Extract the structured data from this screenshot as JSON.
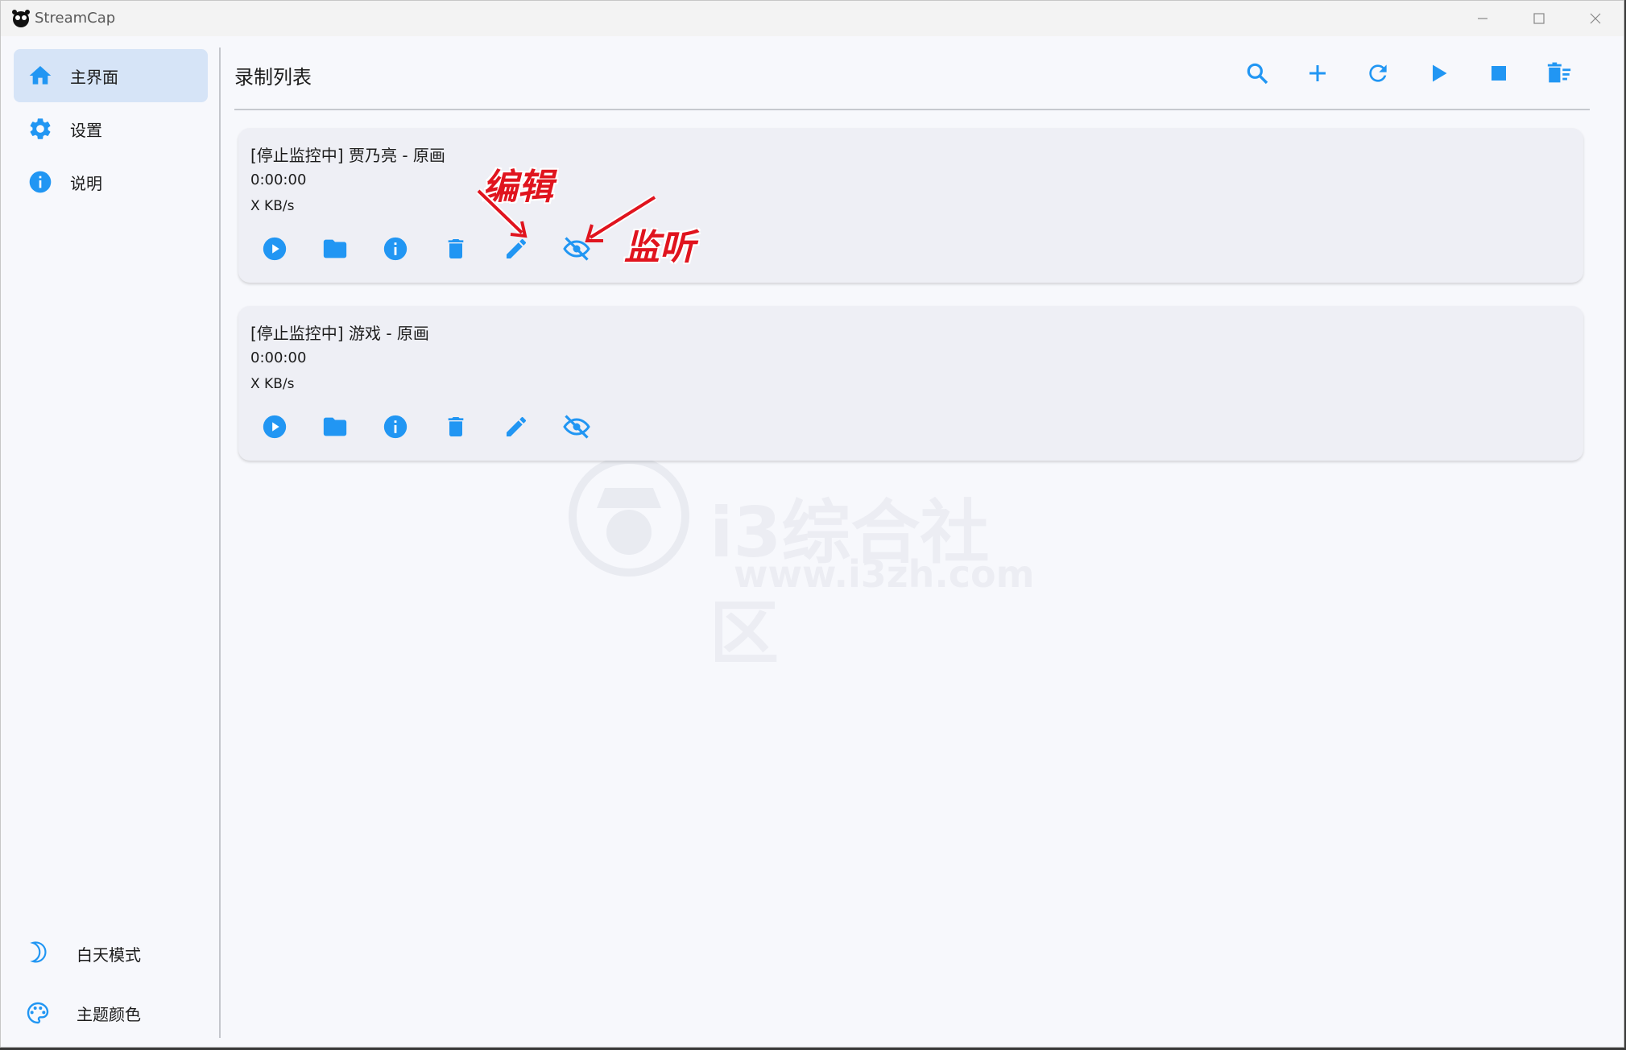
{
  "app": {
    "title": "StreamCap"
  },
  "sidebar": {
    "items": [
      {
        "label": "主界面",
        "icon": "home-icon",
        "active": true
      },
      {
        "label": "设置",
        "icon": "gear-icon",
        "active": false
      },
      {
        "label": "说明",
        "icon": "info-icon",
        "active": false
      }
    ],
    "bottom": [
      {
        "label": "白天模式",
        "icon": "moon-icon"
      },
      {
        "label": "主题颜色",
        "icon": "palette-icon"
      }
    ]
  },
  "main": {
    "title": "录制列表",
    "toolbar": [
      "search-icon",
      "add-icon",
      "refresh-icon",
      "play-icon",
      "stop-icon",
      "delete-all-icon"
    ]
  },
  "recordings": [
    {
      "title": "[停止监控中] 贾乃亮 - 原画",
      "duration": "0:00:00",
      "speed": "X KB/s"
    },
    {
      "title": "[停止监控中] 游戏 - 原画",
      "duration": "0:00:00",
      "speed": "X KB/s"
    }
  ],
  "annotations": {
    "edit": "编辑",
    "listen": "监听"
  },
  "watermark": {
    "text": "i3综合社区",
    "url": "www.i3zh.com"
  },
  "colors": {
    "accent": "#2196f3",
    "annotation": "#e0141e",
    "active_bg": "#d6e4f7"
  }
}
